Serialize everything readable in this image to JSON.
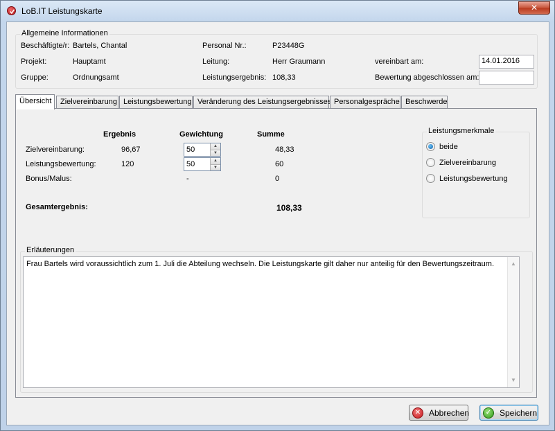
{
  "window": {
    "title": "LoB.IT Leistungskarte",
    "close_label": "✕"
  },
  "general": {
    "legend": "Allgemeine Informationen",
    "employee_label": "Beschäftigte/r:",
    "employee_value": "Bartels, Chantal",
    "personal_nr_label": "Personal Nr.:",
    "personal_nr_value": "P23448G",
    "project_label": "Projekt:",
    "project_value": "Hauptamt",
    "lead_label": "Leitung:",
    "lead_value": "Herr Graumann",
    "agreed_label": "vereinbart am:",
    "agreed_value": "14.01.2016",
    "group_label": "Gruppe:",
    "group_value": "Ordnungsamt",
    "result_label": "Leistungsergebnis:",
    "result_value": "108,33",
    "closed_label": "Bewertung abgeschlossen am:",
    "closed_value": ""
  },
  "tabs": [
    {
      "label": "Übersicht",
      "active": true
    },
    {
      "label": "Zielvereinbarung",
      "active": false
    },
    {
      "label": "Leistungsbewertung",
      "active": false
    },
    {
      "label": "Veränderung des Leistungsergebnisses",
      "active": false
    },
    {
      "label": "Personalgespräche",
      "active": false
    },
    {
      "label": "Beschwerde",
      "active": false
    }
  ],
  "overview": {
    "col_result": "Ergebnis",
    "col_weight": "Gewichtung",
    "col_sum": "Summe",
    "rows": [
      {
        "label": "Zielvereinbarung:",
        "result": "96,67",
        "weight": "50",
        "sum": "48,33"
      },
      {
        "label": "Leistungsbewertung:",
        "result": "120",
        "weight": "50",
        "sum": "60"
      },
      {
        "label": "Bonus/Malus:",
        "result": "",
        "weight": "-",
        "sum": "0"
      }
    ],
    "total_label": "Gesamtergebnis:",
    "total_value": "108,33"
  },
  "features": {
    "legend": "Leistungsmerkmale",
    "options": [
      {
        "label": "beide",
        "checked": true
      },
      {
        "label": "Zielvereinbarung",
        "checked": false
      },
      {
        "label": "Leistungsbewertung",
        "checked": false
      }
    ]
  },
  "notes": {
    "legend": "Erläuterungen",
    "text": "Frau Bartels wird voraussichtlich zum 1. Juli die Abteilung wechseln. Die Leistungskarte gilt daher nur anteilig für den Bewertungszeitraum."
  },
  "buttons": {
    "cancel": "Abbrechen",
    "save": "Speichern"
  },
  "icons": {
    "app": "app-logo-icon",
    "cancel": "cancel-icon",
    "save": "checkmark-icon"
  }
}
